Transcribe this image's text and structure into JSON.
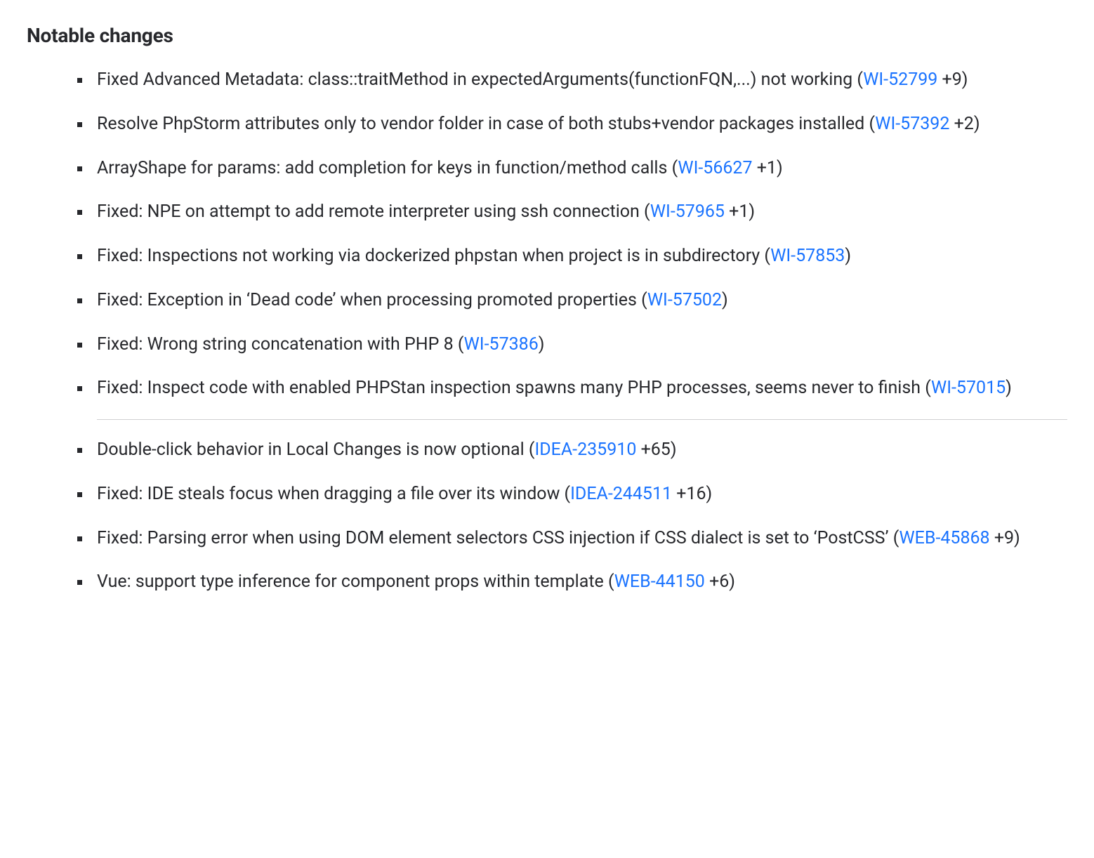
{
  "heading": "Notable changes",
  "items": [
    {
      "text_before": "Fixed Advanced Metadata: class::traitMethod in expectedArguments(functionFQN,...) not working (",
      "link_text": "WI-52799",
      "suffix": " +9)",
      "after_hr": false
    },
    {
      "text_before": "Resolve PhpStorm attributes only to vendor folder in case of both stubs+vendor packages installed (",
      "link_text": "WI-57392",
      "suffix": " +2)",
      "after_hr": false
    },
    {
      "text_before": "ArrayShape for params: add completion for keys in function/method calls (",
      "link_text": "WI-56627",
      "suffix": " +1)",
      "after_hr": false
    },
    {
      "text_before": "Fixed: NPE on attempt to add remote interpreter using ssh connection (",
      "link_text": "WI-57965",
      "suffix": " +1)",
      "after_hr": false
    },
    {
      "text_before": "Fixed: Inspections not working via dockerized phpstan when project is in subdirectory (",
      "link_text": "WI-57853",
      "suffix": ")",
      "after_hr": false
    },
    {
      "text_before": "Fixed: Exception in ‘Dead code’ when processing promoted properties (",
      "link_text": "WI-57502",
      "suffix": ")",
      "after_hr": false
    },
    {
      "text_before": "Fixed: Wrong string concatenation with PHP 8 (",
      "link_text": "WI-57386",
      "suffix": ")",
      "after_hr": false
    },
    {
      "text_before": "Fixed: Inspect code with enabled PHPStan inspection spawns many PHP processes, seems never to finish (",
      "link_text": "WI-57015",
      "suffix": ")",
      "after_hr": false
    },
    {
      "text_before": "Double-click behavior in Local Changes is now optional (",
      "link_text": "IDEA-235910",
      "suffix": " +65)",
      "after_hr": true
    },
    {
      "text_before": "Fixed: IDE steals focus when dragging a file over its window (",
      "link_text": "IDEA-244511",
      "suffix": " +16)",
      "after_hr": false
    },
    {
      "text_before": "Fixed: Parsing error when using DOM element selectors CSS injection if CSS dialect is set to ‘PostCSS’ (",
      "link_text": "WEB-45868",
      "suffix": " +9)",
      "after_hr": false
    },
    {
      "text_before": "Vue: support type inference for component props within template (",
      "link_text": "WEB-44150",
      "suffix": " +6)",
      "after_hr": false
    }
  ]
}
